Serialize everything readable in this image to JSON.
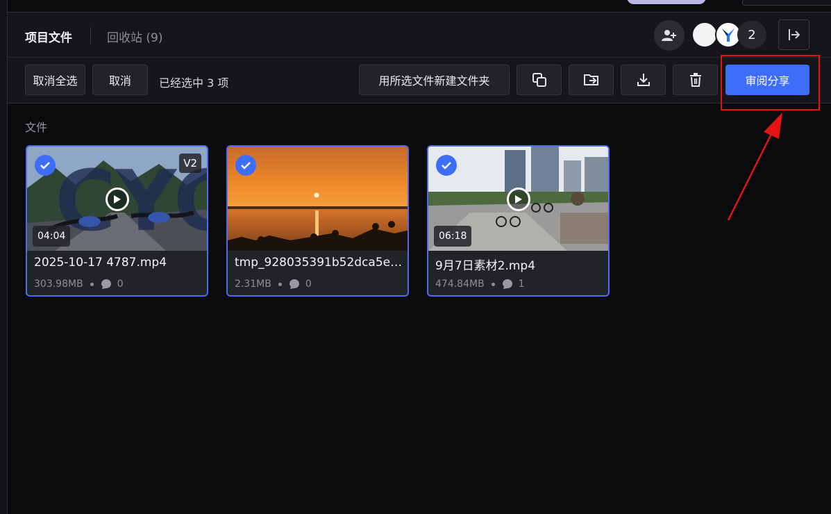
{
  "tabs": {
    "files": "项目文件",
    "trash": "回收站 (9)"
  },
  "members": {
    "count": "2"
  },
  "toolbar": {
    "deselect_all": "取消全选",
    "cancel": "取消",
    "selected_text": "已经选中 3 项",
    "new_folder": "用所选文件新建文件夹",
    "share": "审阅分享"
  },
  "section": {
    "label": "文件"
  },
  "files": [
    {
      "name": "2025-10-17 4787.mp4",
      "size": "303.98MB",
      "comments": "0",
      "duration": "04:04",
      "version": "V2",
      "selected": true
    },
    {
      "name": "tmp_928035391b52dca5e4...",
      "size": "2.31MB",
      "comments": "0",
      "selected": true
    },
    {
      "name": "9月7日素材2.mp4",
      "size": "474.84MB",
      "comments": "1",
      "duration": "06:18",
      "selected": true
    }
  ],
  "colors": {
    "accent": "#3e6df7",
    "highlight": "#e41414",
    "background": "#0b0b0e",
    "panel": "#15151a"
  },
  "icons": [
    "add-user-icon",
    "logo-icon",
    "exit-icon",
    "copy-icon",
    "move-folder-icon",
    "download-icon",
    "trash-icon",
    "check-icon",
    "play-icon",
    "comment-icon"
  ]
}
